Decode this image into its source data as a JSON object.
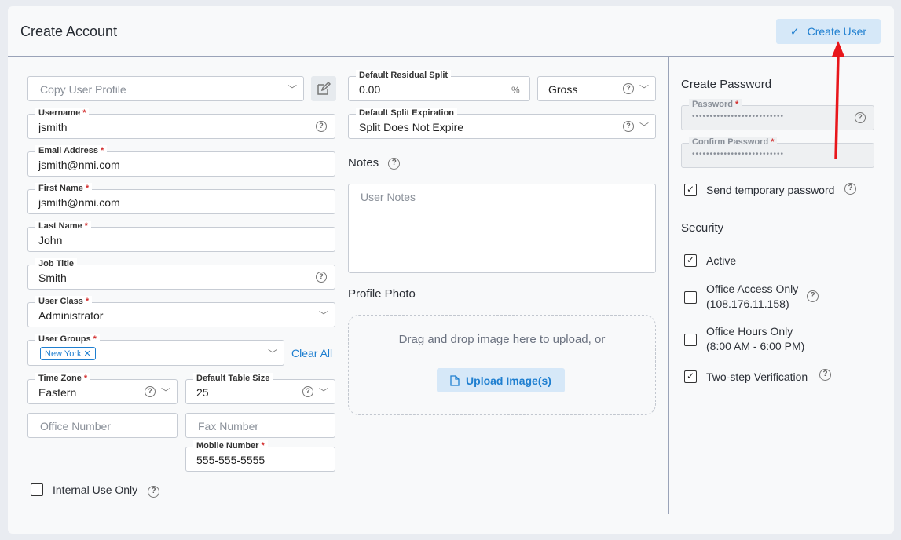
{
  "header": {
    "title": "Create Account",
    "create_button": "Create User"
  },
  "left": {
    "copy_profile": {
      "placeholder": "Copy User Profile"
    },
    "username": {
      "label": "Username",
      "value": "jsmith"
    },
    "email": {
      "label": "Email Address",
      "value": "jsmith@nmi.com"
    },
    "first_name": {
      "label": "First Name",
      "value": "jsmith@nmi.com"
    },
    "last_name": {
      "label": "Last Name",
      "value": "John"
    },
    "job_title": {
      "label": "Job Title",
      "value": "Smith"
    },
    "user_class": {
      "label": "User Class",
      "value": "Administrator"
    },
    "user_groups": {
      "label": "User Groups",
      "tag": "New York",
      "clear_all": "Clear All"
    },
    "time_zone": {
      "label": "Time Zone",
      "value": "Eastern"
    },
    "table_size": {
      "label": "Default Table Size",
      "value": "25"
    },
    "office_number": {
      "placeholder": "Office Number"
    },
    "fax_number": {
      "placeholder": "Fax Number"
    },
    "mobile": {
      "label": "Mobile Number",
      "value": "555-555-5555"
    },
    "internal_use": {
      "label": "Internal Use Only",
      "checked": false
    }
  },
  "middle": {
    "residual_split": {
      "label": "Default Residual Split",
      "value": "0.00",
      "unit": "%"
    },
    "gross": {
      "value": "Gross"
    },
    "split_expiration": {
      "label": "Default Split Expiration",
      "value": "Split Does Not Expire"
    },
    "notes": {
      "title": "Notes",
      "placeholder": "User Notes"
    },
    "profile_photo": {
      "title": "Profile Photo",
      "drop_text": "Drag and drop image here to upload, or",
      "upload_button": "Upload Image(s)"
    }
  },
  "right": {
    "create_password": "Create Password",
    "password": {
      "label": "Password",
      "dots": "••••••••••••••••••••••••••"
    },
    "confirm_password": {
      "label": "Confirm Password",
      "dots": "••••••••••••••••••••••••••"
    },
    "send_temp": {
      "label": "Send temporary password",
      "checked": true
    },
    "security": "Security",
    "active": {
      "label": "Active",
      "checked": true
    },
    "office_access": {
      "line1": "Office Access Only",
      "line2": "(108.176.11.158)",
      "checked": false
    },
    "office_hours": {
      "line1": "Office Hours Only",
      "line2": "(8:00 AM - 6:00 PM)",
      "checked": false
    },
    "two_step": {
      "label": "Two-step Verification",
      "checked": true
    }
  },
  "icons": {
    "check": "check-icon",
    "chevron": "chevron-down-icon",
    "help": "help-icon",
    "edit": "edit-icon",
    "file": "file-icon",
    "close": "close-icon"
  },
  "colors": {
    "accent": "#1f7fd0",
    "button_bg": "#d6e8f8",
    "required": "#d32f2f",
    "annotation_arrow": "#e8161b"
  }
}
